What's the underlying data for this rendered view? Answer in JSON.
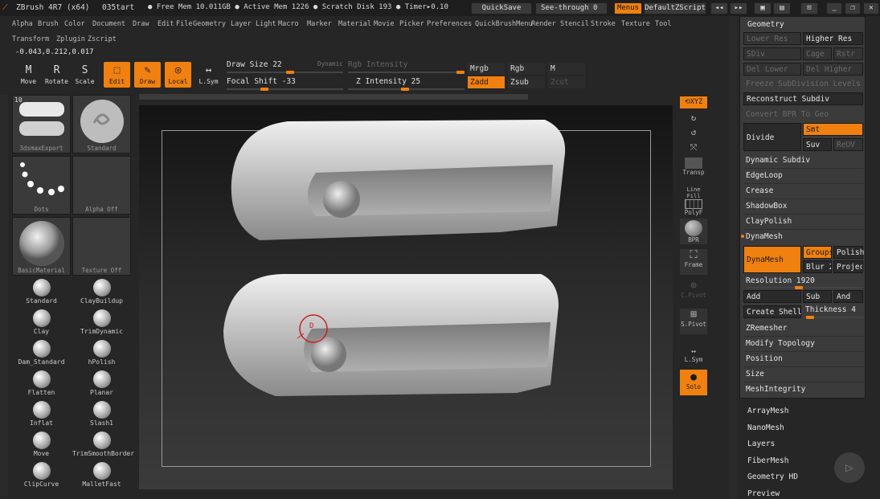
{
  "titlebar": {
    "app": "ZBrush 4R7 (x64)",
    "doc": "035tart",
    "free_mem": "● Free Mem 10.011GB ● Active Mem 1226 ● Scratch Disk 193 ● Timer▸0.10",
    "quicksave": "QuickSave",
    "seethrough": "See-through  0",
    "menus": "Menus",
    "defaultzscript": "DefaultZScript"
  },
  "menu1": [
    "Alpha",
    "Brush",
    "Color",
    "Document",
    "Draw",
    "Edit",
    "File",
    "Geometry",
    "Layer",
    "Light",
    "Macro",
    "Marker",
    "Material",
    "Movie",
    "Picker",
    "Preferences",
    "QuickBrushMenu",
    "Render",
    "Stencil",
    "Stroke",
    "Texture",
    "Tool"
  ],
  "menu2": [
    "Transform",
    "Zplugin",
    "Zscript"
  ],
  "coords": "-0.043,0.212,0.017",
  "tools": [
    {
      "label": "Move",
      "glyph": "M"
    },
    {
      "label": "Rotate",
      "glyph": "R"
    },
    {
      "label": "Scale",
      "glyph": "S"
    },
    {
      "label": "Edit",
      "glyph": "⬚"
    },
    {
      "label": "Draw",
      "glyph": "✎"
    },
    {
      "label": "Local",
      "glyph": "◎"
    },
    {
      "label": "L.Sym",
      "glyph": "↔"
    }
  ],
  "params": {
    "draw_size": "Draw Size 22",
    "dynamic": "Dynamic",
    "rgb_intensity": "Rgb Intensity",
    "focal_shift": "Focal Shift -33",
    "z_intensity": "Z Intensity 25",
    "mrgb": "Mrgb",
    "rgb": "Rgb",
    "m": "M",
    "zadd": "Zadd",
    "zsub": "Zsub",
    "zcut": "Zcut",
    "draw_size_value": 22,
    "focal_shift_value": -33,
    "z_intensity_value": 25
  },
  "left_thumbs": [
    {
      "cap": "3dsmaxExport"
    },
    {
      "cap": "Standard"
    },
    {
      "cap": "Dots"
    },
    {
      "cap": "Alpha  Off"
    },
    {
      "cap": "BasicMaterial"
    },
    {
      "cap": "Texture  Off"
    }
  ],
  "thumb_count": "10",
  "brushes": [
    "Standard",
    "ClayBuildup",
    "Clay",
    "TrimDynamic",
    "Dam_Standard",
    "hPolish",
    "Flatten",
    "Planar",
    "Inflat",
    "Slash1",
    "Move",
    "TrimSmoothBorder",
    "ClipCurve",
    "MalletFast"
  ],
  "right_tools": {
    "xyz": "XYZ",
    "transp": "Transp",
    "polyf": "PolyF",
    "linefill": "Line Fill",
    "bpr": "BPR",
    "frame": "Frame",
    "cpivot": "C.Pivot",
    "spivot": "S.Pivot",
    "lsym": "L.Sym",
    "solo": "Solo"
  },
  "cursor_label": "D",
  "geometry": {
    "title": "Geometry",
    "lower_res": "Lower Res",
    "higher_res": "Higher Res",
    "sdiv": "SDiv",
    "cage": "Cage",
    "rstr": "Rstr",
    "del_lower": "Del Lower",
    "del_higher": "Del Higher",
    "freeze": "Freeze SubDivision Levels",
    "reconstruct": "Reconstruct Subdiv",
    "convert_bpr": "Convert BPR To Geo",
    "divide": "Divide",
    "smt": "Smt",
    "suv": "Suv",
    "reuv": "ReUV",
    "dynamic_subdiv": "Dynamic Subdiv",
    "edgeloop": "EdgeLoop",
    "crease": "Crease",
    "shadowbox": "ShadowBox",
    "claypolish": "ClayPolish",
    "dynamesh_hdr": "DynaMesh",
    "dynamesh_btn": "DynaMesh",
    "groups": "Groups",
    "polish": "Polish",
    "blur": "Blur 2",
    "project": "Projec",
    "resolution": "Resolution 1920",
    "resolution_value": 1920,
    "add": "Add",
    "sub": "Sub",
    "and": "And",
    "create_shell": "Create Shell",
    "thickness": "Thickness 4",
    "zremesher": "ZRemesher",
    "modify_topology": "Modify Topology",
    "position": "Position",
    "size": "Size",
    "meshintegrity": "MeshIntegrity"
  },
  "subpalettes": [
    "ArrayMesh",
    "NanoMesh",
    "Layers",
    "FiberMesh",
    "Geometry HD",
    "Preview"
  ],
  "colors": {
    "accent": "#f08010",
    "panel": "#3b3b3b",
    "bg": "#262626"
  }
}
